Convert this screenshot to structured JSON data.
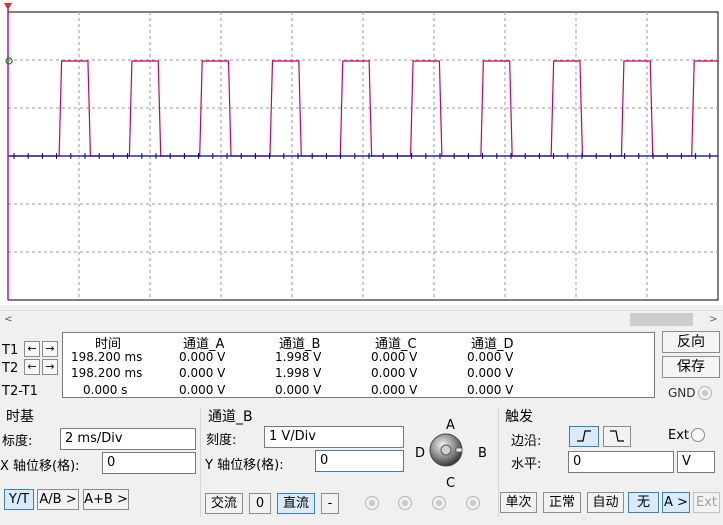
{
  "cursor": {
    "t1_label": "T1",
    "t2_label": "T2",
    "diff_label": "T2-T1",
    "headers": [
      "时间",
      "通道_A",
      "通道_B",
      "通道_C",
      "通道_D"
    ],
    "rows": [
      [
        "198.200 ms",
        "0.000 V",
        "1.998 V",
        "0.000 V",
        "0.000 V"
      ],
      [
        "198.200 ms",
        "0.000 V",
        "1.998 V",
        "0.000 V",
        "0.000 V"
      ],
      [
        "0.000 s",
        "0.000 V",
        "0.000 V",
        "0.000 V",
        "0.000 V"
      ]
    ]
  },
  "side": {
    "reverse": "反向",
    "save": "保存",
    "gnd": "GND"
  },
  "timebase": {
    "title": "时基",
    "scale_label": "标度:",
    "scale_value": "2 ms/Div",
    "xpos_label": "X 轴位移(格):",
    "xpos_value": "0",
    "modes": [
      "Y/T",
      "A/B >",
      "A+B >"
    ]
  },
  "channel": {
    "title": "通道_B",
    "scale_label": "刻度:",
    "scale_value": "1  V/Div",
    "ypos_label": "Y 轴位移(格):",
    "ypos_value": "0",
    "coupling": [
      "交流",
      "0",
      "直流",
      "-"
    ],
    "knob_labels": {
      "top": "A",
      "left": "D",
      "right": "B",
      "bottom": "C"
    }
  },
  "trigger": {
    "title": "触发",
    "edge_label": "边沿:",
    "ext_label": "Ext",
    "level_label": "水平:",
    "level_value": "0",
    "level_unit": "V",
    "modes": [
      "单次",
      "正常",
      "自动",
      "无",
      "A >",
      "Ext"
    ]
  },
  "colors": {
    "channel_b_trace": "#cc0066",
    "channel_a_trace": "#000080",
    "cursor_line": "#cc00cc",
    "active_button": "#d9ebf9"
  }
}
